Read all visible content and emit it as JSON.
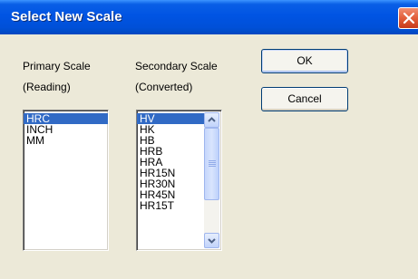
{
  "window": {
    "title": "Select New Scale"
  },
  "primary": {
    "label_line1": "Primary Scale",
    "label_line2": "(Reading)",
    "items": [
      "HRC",
      "INCH",
      "MM"
    ],
    "selected": "HRC"
  },
  "secondary": {
    "label_line1": "Secondary Scale",
    "label_line2": "(Converted)",
    "items": [
      "HV",
      "HK",
      "HB",
      "HRB",
      "HRA",
      "HR15N",
      "HR30N",
      "HR45N",
      "HR15T"
    ],
    "selected": "HV"
  },
  "buttons": {
    "ok": "OK",
    "cancel": "Cancel"
  },
  "icons": {
    "close": "close-icon",
    "scroll_up": "chevron-up-icon",
    "scroll_down": "chevron-down-icon"
  },
  "colors": {
    "title_bar": "#0054e3",
    "close_button": "#e25e3a",
    "selection": "#316ac5",
    "dialog_bg": "#ece9d8"
  }
}
